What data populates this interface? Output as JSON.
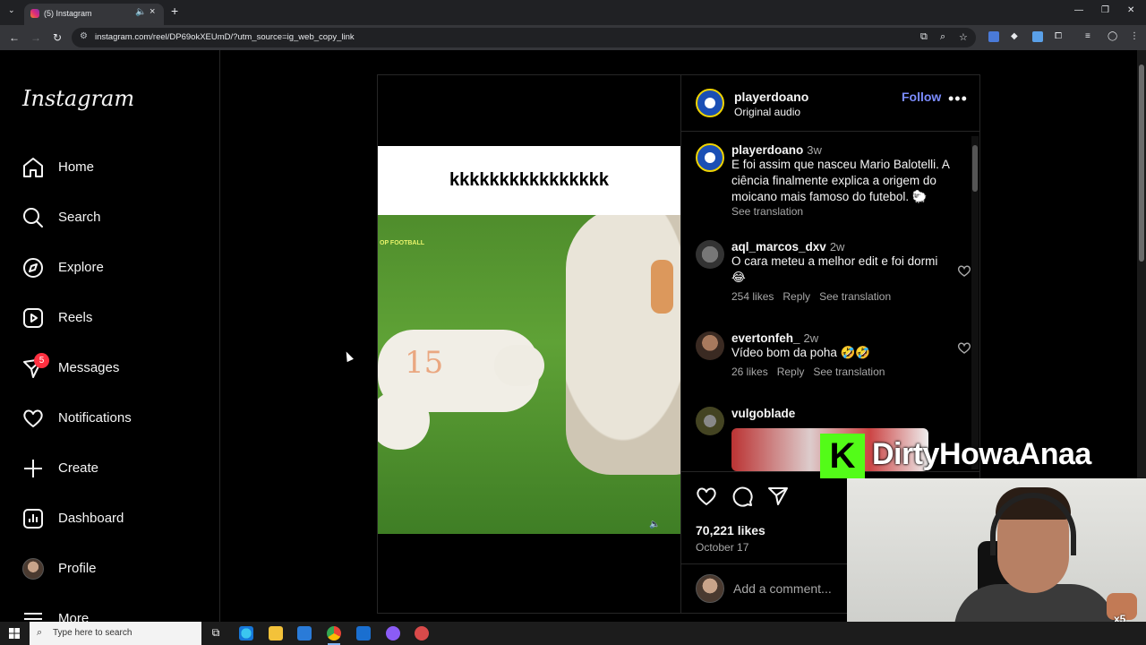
{
  "browser": {
    "tab_title": "(5) Instagram",
    "url": "instagram.com/reel/DP69okXEUmD/?utm_source=ig_web_copy_link"
  },
  "sidebar": {
    "logo": "Instagram",
    "items": [
      {
        "label": "Home",
        "icon": "home-icon"
      },
      {
        "label": "Search",
        "icon": "search-icon"
      },
      {
        "label": "Explore",
        "icon": "compass-icon"
      },
      {
        "label": "Reels",
        "icon": "reels-icon"
      },
      {
        "label": "Messages",
        "icon": "messenger-icon",
        "badge": "5"
      },
      {
        "label": "Notifications",
        "icon": "heart-icon"
      },
      {
        "label": "Create",
        "icon": "plus-icon"
      },
      {
        "label": "Dashboard",
        "icon": "dashboard-icon"
      },
      {
        "label": "Profile",
        "icon": "avatar"
      },
      {
        "label": "More",
        "icon": "menu-icon"
      }
    ]
  },
  "post": {
    "media_caption": "kkkkkkkkkkkkkkkk",
    "media_watermark": "OP FOOTBALL",
    "media_mark": "15",
    "author": "playerdoano",
    "audio": "Original audio",
    "follow_label": "Follow",
    "caption": {
      "user": "playerdoano",
      "time": "3w",
      "text": "E foi assim que nasceu Mario Balotelli. A ciência finalmente explica a origem do moicano mais famoso do futebol. 🐑",
      "see_translation": "See translation"
    },
    "comments": [
      {
        "user": "aql_marcos_dxv",
        "time": "2w",
        "text": "O cara meteu a melhor edit e foi dormi 😂",
        "likes": "254 likes",
        "reply": "Reply",
        "translate": "See translation"
      },
      {
        "user": "evertonfeh_",
        "time": "2w",
        "text": "Vídeo bom da poha 🤣🤣",
        "likes": "26 likes",
        "reply": "Reply",
        "translate": "See translation"
      },
      {
        "user": "vulgoblade",
        "time": "",
        "text": ""
      }
    ],
    "likes": "70,221 likes",
    "date": "October 17",
    "add_comment_placeholder": "Add a comment..."
  },
  "overlay": {
    "kick_logo": "K",
    "streamer": "DirtyHowaAnaa",
    "multiplier": "x5"
  },
  "taskbar": {
    "search_placeholder": "Type here to search"
  },
  "colors": {
    "follow": "#7b8cff",
    "badge": "#ff3040",
    "kick_green": "#53fc18"
  }
}
